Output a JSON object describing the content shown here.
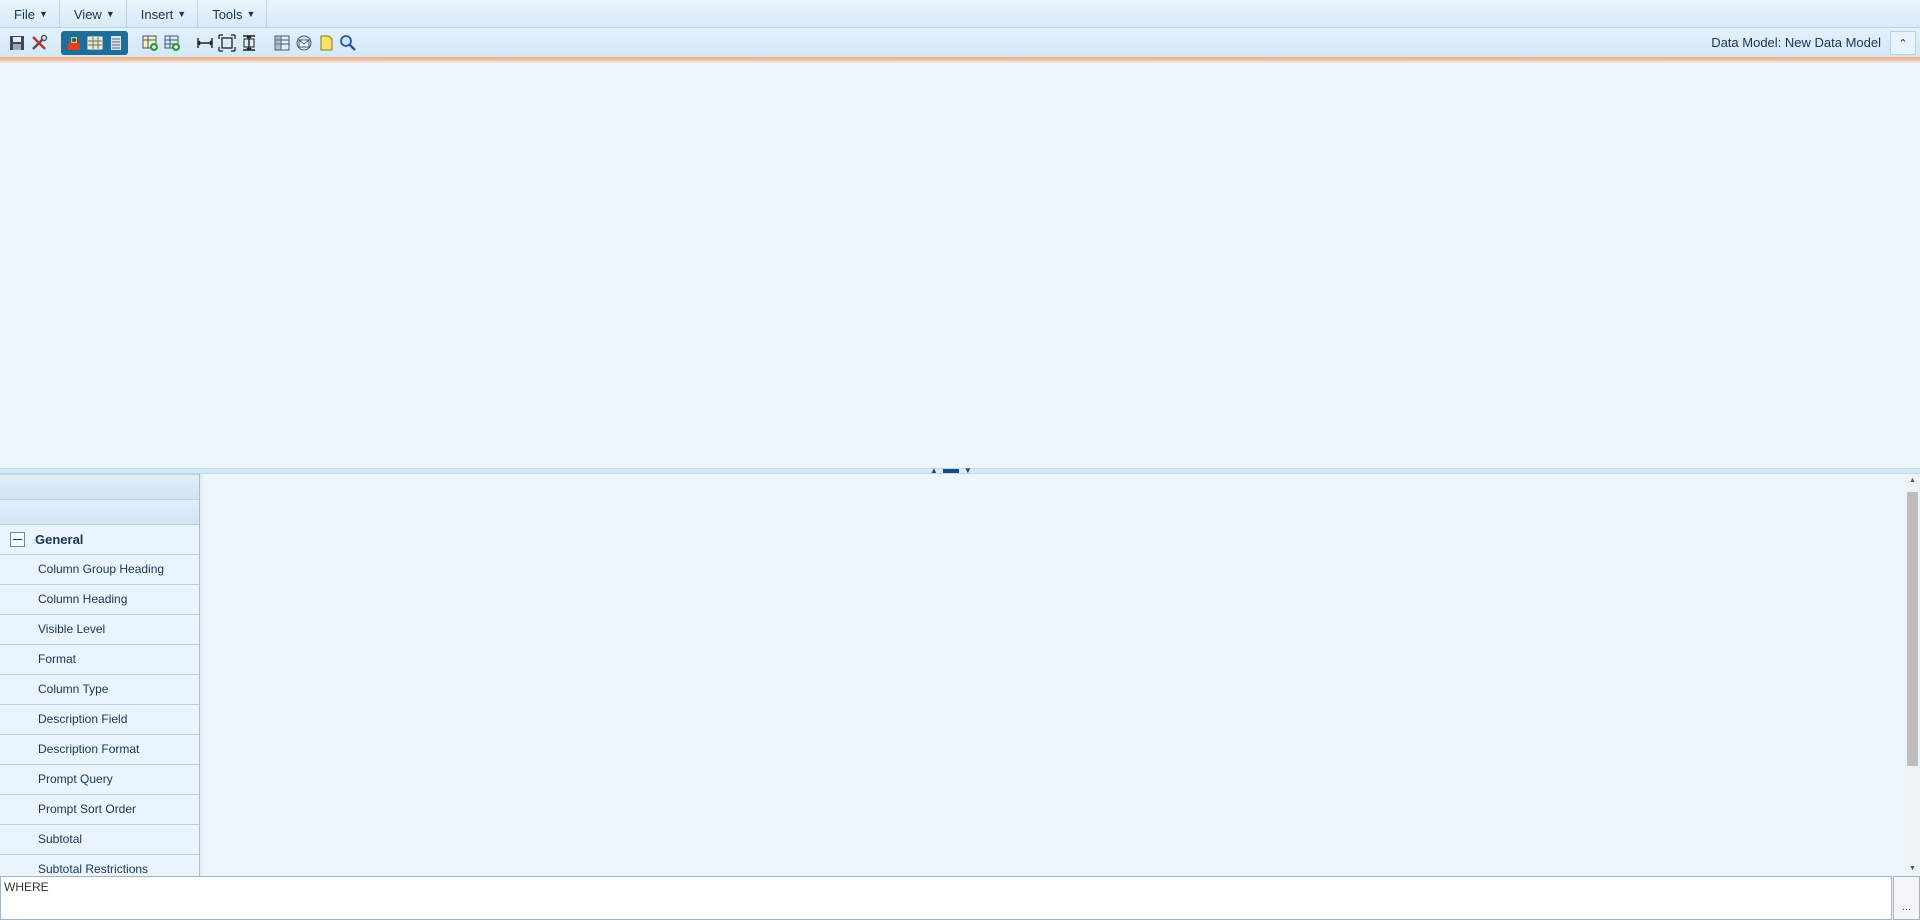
{
  "menubar": {
    "items": [
      {
        "label": "File"
      },
      {
        "label": "View"
      },
      {
        "label": "Insert"
      },
      {
        "label": "Tools"
      }
    ]
  },
  "toolbar": {
    "data_model_label": "Data Model: New Data Model",
    "icons": [
      "save-icon",
      "tools-icon",
      "query-view-icon",
      "grid-view-icon",
      "list-view-icon",
      "add-table-icon",
      "add-view-icon",
      "fit-width-icon",
      "fit-page-icon",
      "fit-height-icon",
      "columns-icon",
      "mail-icon",
      "note-icon",
      "search-icon"
    ],
    "collapse_icon": "chevron-up-icon"
  },
  "properties": {
    "section_title": "General",
    "rows": [
      "Column Group Heading",
      "Column Heading",
      "Visible Level",
      "Format",
      "Column Type",
      "Description Field",
      "Description Format",
      "Prompt Query",
      "Prompt Sort Order",
      "Subtotal",
      "Subtotal Restrictions"
    ]
  },
  "where_box": {
    "value": "WHERE",
    "button_label": "..."
  },
  "colors": {
    "accent": "#f0a678",
    "active_toolbar": "#1e6e9c",
    "panel_bg": "#eaf4fc"
  }
}
